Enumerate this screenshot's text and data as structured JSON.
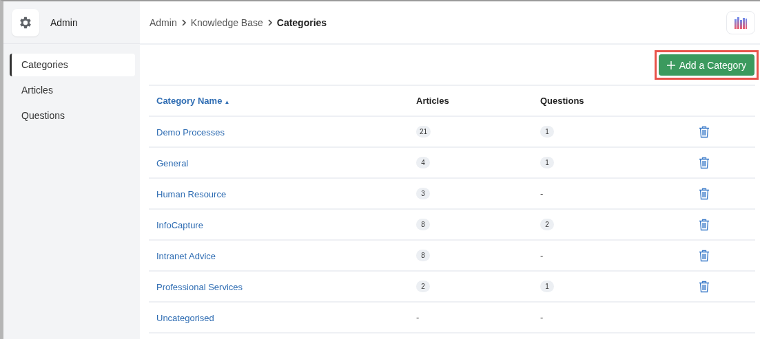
{
  "sidebar": {
    "title": "Admin",
    "items": [
      {
        "label": "Categories",
        "selected": true
      },
      {
        "label": "Articles",
        "selected": false
      },
      {
        "label": "Questions",
        "selected": false
      }
    ]
  },
  "breadcrumb": {
    "items": [
      "Admin",
      "Knowledge Base"
    ],
    "current": "Categories"
  },
  "toolbar": {
    "add_button": "Add a Category",
    "highlighted": true
  },
  "table": {
    "columns": [
      {
        "label": "Category Name",
        "sort_indicator": "▲",
        "sortable": true
      },
      {
        "label": "Articles",
        "sortable": false
      },
      {
        "label": "Questions",
        "sortable": false
      }
    ],
    "rows": [
      {
        "name": "Demo Processes",
        "articles": {
          "kind": "badge",
          "text": "21"
        },
        "questions": {
          "kind": "badge",
          "text": "1"
        },
        "deletable": true
      },
      {
        "name": "General",
        "articles": {
          "kind": "badge",
          "text": "4"
        },
        "questions": {
          "kind": "badge",
          "text": "1"
        },
        "deletable": true
      },
      {
        "name": "Human Resource",
        "articles": {
          "kind": "badge",
          "text": "3"
        },
        "questions": {
          "kind": "plain",
          "text": "-"
        },
        "deletable": true
      },
      {
        "name": "InfoCapture",
        "articles": {
          "kind": "badge",
          "text": "8"
        },
        "questions": {
          "kind": "badge",
          "text": "2"
        },
        "deletable": true
      },
      {
        "name": "Intranet Advice",
        "articles": {
          "kind": "badge",
          "text": "8"
        },
        "questions": {
          "kind": "plain",
          "text": "-"
        },
        "deletable": true
      },
      {
        "name": "Professional Services",
        "articles": {
          "kind": "badge",
          "text": "2"
        },
        "questions": {
          "kind": "badge",
          "text": "1"
        },
        "deletable": true
      },
      {
        "name": "Uncategorised",
        "articles": {
          "kind": "plain",
          "text": "-"
        },
        "questions": {
          "kind": "plain",
          "text": "-"
        },
        "deletable": false
      }
    ]
  }
}
